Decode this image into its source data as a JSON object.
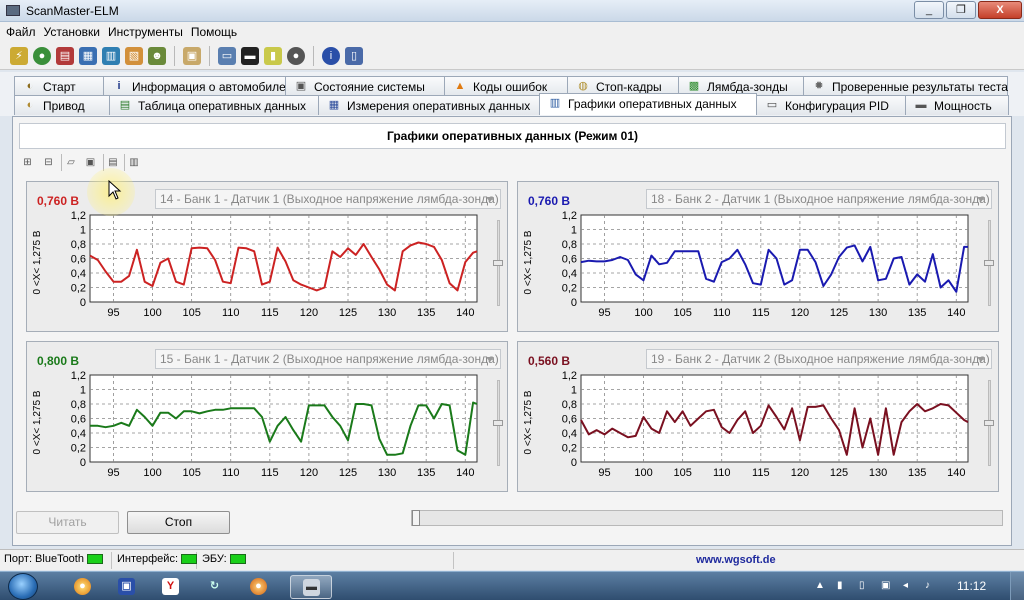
{
  "window": {
    "title": "ScanMaster-ELM",
    "min": "_",
    "max": "❐",
    "close": "X"
  },
  "menu": [
    "Файл",
    "Установки",
    "Инструменты",
    "Помощь"
  ],
  "tabs_row1": [
    {
      "label": "Старт",
      "icon": "meter-icon"
    },
    {
      "label": "Информация о автомобиле",
      "icon": "info-icon"
    },
    {
      "label": "Состояние системы",
      "icon": "system-icon"
    },
    {
      "label": "Коды ошибок",
      "icon": "warning-icon"
    },
    {
      "label": "Стоп-кадры",
      "icon": "freeze-frame-icon"
    },
    {
      "label": "Лямбда-зонды",
      "icon": "lambda-icon"
    },
    {
      "label": "Проверенные результаты теста",
      "icon": "gear-icon"
    }
  ],
  "tabs_row2": [
    {
      "label": "Привод",
      "icon": "drive-icon"
    },
    {
      "label": "Таблица оперативных данных",
      "icon": "table-icon"
    },
    {
      "label": "Измерения оперативных данных",
      "icon": "grid-icon"
    },
    {
      "label": "Графики оперативных данных",
      "icon": "chart-icon",
      "active": true
    },
    {
      "label": "Конфигурация PID",
      "icon": "config-icon"
    },
    {
      "label": "Мощность",
      "icon": "power-icon"
    }
  ],
  "panel": {
    "title": "Графики оперативных данных (Режим 01)"
  },
  "buttons": {
    "read": "Читать",
    "stop": "Стоп"
  },
  "status": {
    "port": "Порт: BlueTooth",
    "interface": "Интерфейс:",
    "ecu": "ЭБУ:",
    "link": "www.wgsoft.de"
  },
  "taskbar": {
    "clock": "11:12"
  },
  "chart_data": [
    {
      "type": "line",
      "value_label": "0,760 В",
      "pid": "14 - Банк 1 - Датчик 1 (Выходное напряжение лямбда-зонда)",
      "color": "#cc2222",
      "ylabel": "0 <X< 1,275 В",
      "ylim": [
        0,
        1.2
      ],
      "yticks": [
        "0",
        "0,2",
        "0,4",
        "0,6",
        "0,8",
        "1",
        "1,2"
      ],
      "xticks": [
        95,
        100,
        105,
        110,
        115,
        120,
        125,
        130,
        135,
        140
      ],
      "xlim": [
        92,
        141.5
      ],
      "grid": true,
      "x": [
        92,
        93,
        94,
        95,
        96,
        97,
        98,
        99,
        100,
        101,
        102,
        103,
        104,
        105,
        106,
        107,
        108,
        109,
        110,
        111,
        112,
        113,
        114,
        115,
        116,
        117,
        118,
        119,
        120,
        121,
        122,
        123,
        124,
        125,
        126,
        127,
        128,
        129,
        130,
        131,
        132,
        133,
        134,
        135,
        136,
        137,
        138,
        139,
        140,
        141,
        141.5
      ],
      "values": [
        0.64,
        0.58,
        0.42,
        0.28,
        0.28,
        0.36,
        0.72,
        0.28,
        0.22,
        0.54,
        0.6,
        0.28,
        0.24,
        0.74,
        0.75,
        0.74,
        0.58,
        0.28,
        0.26,
        0.75,
        0.74,
        0.7,
        0.24,
        0.28,
        0.75,
        0.56,
        0.3,
        0.24,
        0.2,
        0.16,
        0.2,
        0.7,
        0.62,
        0.74,
        0.65,
        0.8,
        0.62,
        0.45,
        0.24,
        0.16,
        0.7,
        0.78,
        0.82,
        0.8,
        0.76,
        0.58,
        0.26,
        0.16,
        0.55,
        0.68,
        0.7
      ]
    },
    {
      "type": "line",
      "value_label": "0,760 В",
      "pid": "18 - Банк 2 - Датчик 1 (Выходное напряжение лямбда-зонда)",
      "color": "#1a1ab0",
      "ylabel": "0 <X< 1,275 В",
      "ylim": [
        0,
        1.2
      ],
      "yticks": [
        "0",
        "0,2",
        "0,4",
        "0,6",
        "0,8",
        "1",
        "1,2"
      ],
      "xticks": [
        95,
        100,
        105,
        110,
        115,
        120,
        125,
        130,
        135,
        140
      ],
      "xlim": [
        92,
        141.5
      ],
      "grid": true,
      "x": [
        92,
        93,
        94,
        95,
        96,
        97,
        98,
        99,
        100,
        101,
        102,
        103,
        104,
        105,
        106,
        107,
        108,
        109,
        110,
        111,
        112,
        113,
        114,
        115,
        116,
        117,
        118,
        119,
        120,
        121,
        122,
        123,
        124,
        125,
        126,
        127,
        128,
        129,
        130,
        131,
        132,
        133,
        134,
        135,
        136,
        137,
        138,
        139,
        140,
        141,
        141.5
      ],
      "values": [
        0.55,
        0.57,
        0.56,
        0.56,
        0.58,
        0.62,
        0.58,
        0.38,
        0.3,
        0.64,
        0.52,
        0.54,
        0.7,
        0.7,
        0.7,
        0.7,
        0.32,
        0.28,
        0.55,
        0.6,
        0.72,
        0.52,
        0.26,
        0.24,
        0.72,
        0.6,
        0.24,
        0.3,
        0.72,
        0.72,
        0.55,
        0.22,
        0.38,
        0.62,
        0.75,
        0.78,
        0.56,
        0.76,
        0.3,
        0.32,
        0.6,
        0.62,
        0.24,
        0.38,
        0.28,
        0.66,
        0.2,
        0.3,
        0.14,
        0.76,
        0.76
      ]
    },
    {
      "type": "line",
      "value_label": "0,800 В",
      "pid": "15 - Банк 1 - Датчик 2 (Выходное напряжение лямбда-зонда)",
      "color": "#1a7a1a",
      "ylabel": "0 <X< 1,275 В",
      "ylim": [
        0,
        1.2
      ],
      "yticks": [
        "0",
        "0,2",
        "0,4",
        "0,6",
        "0,8",
        "1",
        "1,2"
      ],
      "xticks": [
        95,
        100,
        105,
        110,
        115,
        120,
        125,
        130,
        135,
        140
      ],
      "xlim": [
        92,
        141.5
      ],
      "grid": true,
      "x": [
        92,
        93,
        94,
        95,
        96,
        97,
        98,
        99,
        100,
        101,
        102,
        103,
        104,
        105,
        106,
        107,
        108,
        109,
        110,
        111,
        112,
        113,
        114,
        115,
        116,
        117,
        118,
        119,
        120,
        121,
        122,
        123,
        124,
        125,
        126,
        127,
        128,
        129,
        130,
        131,
        132,
        133,
        134,
        135,
        136,
        137,
        138,
        139,
        140,
        141,
        141.5
      ],
      "values": [
        0.5,
        0.5,
        0.48,
        0.5,
        0.54,
        0.5,
        0.72,
        0.62,
        0.5,
        0.68,
        0.68,
        0.6,
        0.7,
        0.7,
        0.67,
        0.7,
        0.72,
        0.72,
        0.74,
        0.74,
        0.74,
        0.74,
        0.62,
        0.28,
        0.5,
        0.62,
        0.44,
        0.28,
        0.78,
        0.78,
        0.78,
        0.62,
        0.5,
        0.3,
        0.8,
        0.8,
        0.78,
        0.32,
        0.1,
        0.1,
        0.12,
        0.5,
        0.78,
        0.78,
        0.6,
        0.8,
        0.78,
        0.16,
        0.1,
        0.82,
        0.8
      ]
    },
    {
      "type": "line",
      "value_label": "0,560 В",
      "pid": "19 - Банк 2 - Датчик 2 (Выходное напряжение лямбда-зонда)",
      "color": "#7a1020",
      "ylabel": "0 <X< 1,275 В",
      "ylim": [
        0,
        1.2
      ],
      "yticks": [
        "0",
        "0,2",
        "0,4",
        "0,6",
        "0,8",
        "1",
        "1,2"
      ],
      "xticks": [
        95,
        100,
        105,
        110,
        115,
        120,
        125,
        130,
        135,
        140
      ],
      "xlim": [
        92,
        141.5
      ],
      "grid": true,
      "x": [
        92,
        93,
        94,
        95,
        96,
        97,
        98,
        99,
        100,
        101,
        102,
        103,
        104,
        105,
        106,
        107,
        108,
        109,
        110,
        111,
        112,
        113,
        114,
        115,
        116,
        117,
        118,
        119,
        120,
        121,
        122,
        123,
        124,
        125,
        126,
        127,
        128,
        129,
        130,
        131,
        132,
        133,
        134,
        135,
        136,
        137,
        138,
        139,
        140,
        141,
        141.5
      ],
      "values": [
        0.58,
        0.38,
        0.44,
        0.38,
        0.46,
        0.4,
        0.34,
        0.36,
        0.62,
        0.46,
        0.4,
        0.7,
        0.55,
        0.7,
        0.5,
        0.6,
        0.7,
        0.72,
        0.48,
        0.4,
        0.58,
        0.7,
        0.4,
        0.5,
        0.78,
        0.62,
        0.45,
        0.74,
        0.3,
        0.76,
        0.76,
        0.78,
        0.6,
        0.44,
        0.1,
        0.74,
        0.2,
        0.6,
        0.1,
        0.74,
        0.1,
        0.55,
        0.7,
        0.8,
        0.7,
        0.74,
        0.8,
        0.78,
        0.68,
        0.58,
        0.55
      ]
    }
  ]
}
